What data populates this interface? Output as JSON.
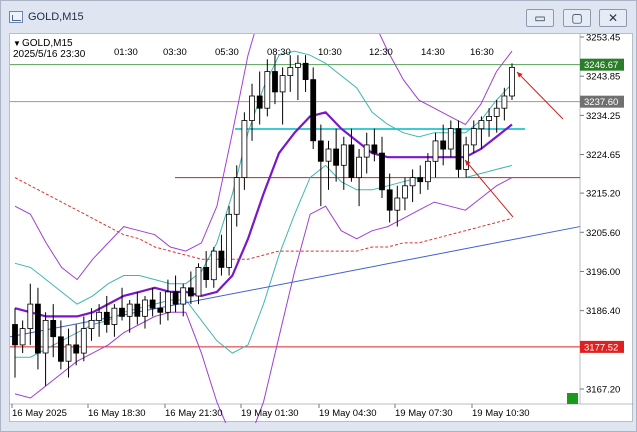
{
  "window": {
    "title": "GOLD,M15"
  },
  "controls": {
    "minimize": "▭",
    "restore": "▢",
    "close": "✕"
  },
  "chart_header": {
    "label": "GOLD,M15",
    "cursor_time": "2025/5/16 23:30"
  },
  "chart_data": {
    "type": "candlestick",
    "symbol": "GOLD",
    "timeframe": "M15",
    "y_ticks": [
      "3253.45",
      "3243.85",
      "3234.25",
      "3224.65",
      "3215.20",
      "3205.60",
      "3196.00",
      "3186.40",
      "3177.52",
      "3167.20"
    ],
    "top_time_ticks": [
      "01:30",
      "03:30",
      "05:30",
      "08:30",
      "10:30",
      "12:30",
      "14:30",
      "16:30"
    ],
    "x_ticks": [
      "16 May 2025",
      "16 May 18:30",
      "16 May 21:30",
      "19 May 01:30",
      "19 May 04:30",
      "19 May 07:30",
      "19 May 10:30"
    ],
    "price_tags": [
      {
        "label": "3246.67",
        "color": "#2b7d2b"
      },
      {
        "label": "3237.60",
        "color": "#707070"
      },
      {
        "label": "3177.52",
        "color": "#e02020"
      }
    ],
    "horizontal_levels": [
      {
        "price": 3246.67,
        "color": "#5aa05a"
      },
      {
        "price": 3237.6,
        "color": "#999999"
      },
      {
        "price": 3230.9,
        "color": "#00b8c8"
      },
      {
        "price": 3219.0,
        "color": "#d02020"
      },
      {
        "price": 3177.52,
        "color": "#e02020"
      }
    ],
    "candles": [
      [
        3183,
        3187,
        3170,
        3178
      ],
      [
        3178,
        3184,
        3176,
        3182
      ],
      [
        3182,
        3193,
        3178,
        3188
      ],
      [
        3188,
        3192,
        3172,
        3176
      ],
      [
        3176,
        3186,
        3168,
        3184
      ],
      [
        3184,
        3188,
        3175,
        3180
      ],
      [
        3180,
        3184,
        3172,
        3174
      ],
      [
        3174,
        3182,
        3170,
        3178
      ],
      [
        3178,
        3183,
        3173,
        3176
      ],
      [
        3176,
        3185,
        3174,
        3182
      ],
      [
        3182,
        3187,
        3179,
        3184
      ],
      [
        3184,
        3188,
        3180,
        3186
      ],
      [
        3186,
        3190,
        3181,
        3183
      ],
      [
        3183,
        3188,
        3180,
        3187
      ],
      [
        3187,
        3192,
        3184,
        3185
      ],
      [
        3185,
        3189,
        3181,
        3188
      ],
      [
        3188,
        3191,
        3183,
        3185
      ],
      [
        3185,
        3190,
        3182,
        3189
      ],
      [
        3189,
        3192,
        3185,
        3187
      ],
      [
        3187,
        3191,
        3183,
        3186
      ],
      [
        3186,
        3194,
        3184,
        3191
      ],
      [
        3191,
        3195,
        3186,
        3188
      ],
      [
        3188,
        3193,
        3185,
        3192
      ],
      [
        3192,
        3196,
        3188,
        3190
      ],
      [
        3190,
        3198,
        3188,
        3197
      ],
      [
        3197,
        3201,
        3192,
        3194
      ],
      [
        3194,
        3202,
        3192,
        3201
      ],
      [
        3201,
        3205,
        3195,
        3197
      ],
      [
        3197,
        3212,
        3195,
        3210
      ],
      [
        3210,
        3222,
        3207,
        3219
      ],
      [
        3219,
        3235,
        3216,
        3233
      ],
      [
        3233,
        3242,
        3228,
        3239
      ],
      [
        3239,
        3245,
        3232,
        3236
      ],
      [
        3236,
        3248,
        3234,
        3245
      ],
      [
        3245,
        3249,
        3237,
        3240
      ],
      [
        3240,
        3246,
        3232,
        3244
      ],
      [
        3244,
        3249,
        3240,
        3246
      ],
      [
        3246,
        3249,
        3238,
        3247
      ],
      [
        3247,
        3249,
        3240,
        3243
      ],
      [
        3243,
        3246,
        3226,
        3228
      ],
      [
        3228,
        3232,
        3212,
        3223
      ],
      [
        3223,
        3228,
        3216,
        3226
      ],
      [
        3226,
        3231,
        3218,
        3222
      ],
      [
        3222,
        3229,
        3216,
        3227
      ],
      [
        3227,
        3231,
        3218,
        3219
      ],
      [
        3219,
        3226,
        3212,
        3224
      ],
      [
        3224,
        3230,
        3220,
        3227
      ],
      [
        3227,
        3231,
        3223,
        3225
      ],
      [
        3225,
        3229,
        3214,
        3216
      ],
      [
        3216,
        3220,
        3208,
        3211
      ],
      [
        3211,
        3217,
        3207,
        3214
      ],
      [
        3214,
        3219,
        3211,
        3217
      ],
      [
        3217,
        3221,
        3213,
        3219
      ],
      [
        3219,
        3222,
        3215,
        3218
      ],
      [
        3218,
        3225,
        3216,
        3223
      ],
      [
        3223,
        3230,
        3219,
        3228
      ],
      [
        3228,
        3232,
        3222,
        3226
      ],
      [
        3226,
        3233,
        3224,
        3231
      ],
      [
        3231,
        3233,
        3219,
        3221
      ],
      [
        3221,
        3229,
        3219,
        3227
      ],
      [
        3227,
        3233,
        3225,
        3231
      ],
      [
        3231,
        3234,
        3226,
        3233
      ],
      [
        3233,
        3236,
        3229,
        3234
      ],
      [
        3234,
        3238,
        3230,
        3236
      ],
      [
        3236,
        3241,
        3233,
        3239
      ],
      [
        3239,
        3247,
        3238,
        3246
      ]
    ],
    "bollinger_outer": {
      "upper": [
        3212,
        3210,
        3203,
        3197,
        3194,
        3199,
        3203,
        3207,
        3206,
        3205,
        3202,
        3201,
        3203,
        3212,
        3230,
        3249,
        3262,
        3269,
        3275,
        3279,
        3279,
        3276,
        3270,
        3258,
        3250,
        3243,
        3238,
        3236,
        3234,
        3232,
        3237,
        3245,
        3250
      ],
      "lower": [
        3166,
        3165,
        3168,
        3171,
        3174,
        3176,
        3178,
        3181,
        3183,
        3185,
        3186,
        3186,
        3176,
        3164,
        3155,
        3154,
        3164,
        3180,
        3196,
        3210,
        3212,
        3206,
        3204,
        3206,
        3207,
        3209,
        3211,
        3213,
        3212,
        3211,
        3214,
        3217,
        3219
      ]
    },
    "bollinger_inner": {
      "upper": [
        3198,
        3197,
        3194,
        3191,
        3188,
        3190,
        3193,
        3195,
        3195,
        3194,
        3193,
        3193,
        3196,
        3203,
        3215,
        3230,
        3241,
        3249,
        3250,
        3249,
        3247,
        3244,
        3241,
        3235,
        3232,
        3230,
        3229,
        3230,
        3230,
        3230,
        3233,
        3238,
        3242
      ],
      "lower": [
        3175,
        3175,
        3177,
        3179,
        3181,
        3183,
        3184,
        3186,
        3187,
        3188,
        3189,
        3189,
        3184,
        3179,
        3176,
        3178,
        3188,
        3200,
        3210,
        3219,
        3222,
        3218,
        3216,
        3216,
        3217,
        3218,
        3219,
        3219,
        3219,
        3219,
        3220,
        3221,
        3222
      ]
    },
    "middle_band": [
      3187,
      3186,
      3185,
      3185,
      3185,
      3186,
      3188,
      3190,
      3191,
      3192,
      3191,
      3191,
      3190,
      3191,
      3195,
      3204,
      3215,
      3225,
      3230,
      3234,
      3235,
      3231,
      3228,
      3225,
      3224,
      3224,
      3224,
      3224,
      3224,
      3224,
      3226,
      3229,
      3232
    ],
    "ma_long": [
      3219,
      3217,
      3215,
      3213,
      3211,
      3209,
      3207,
      3205,
      3204,
      3202,
      3201,
      3200,
      3199,
      3199,
      3199,
      3199,
      3200,
      3201,
      3201,
      3201,
      3201,
      3201,
      3201,
      3202,
      3202,
      3203,
      3203,
      3204,
      3205,
      3206,
      3207,
      3208,
      3209
    ],
    "trendline": [
      [
        0,
        3180
      ],
      [
        1,
        3207
      ]
    ]
  }
}
